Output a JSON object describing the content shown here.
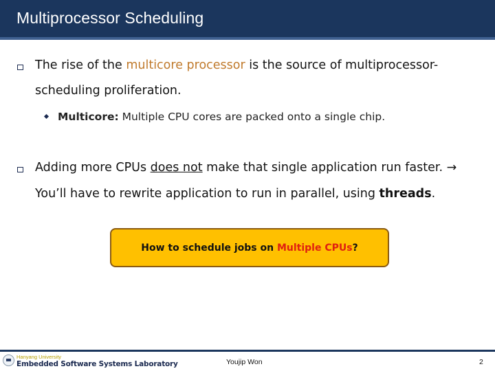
{
  "slide": {
    "title": "Multiprocessor Scheduling"
  },
  "bullets": [
    {
      "line1_pre": "The rise of the ",
      "line1_highlight": "multicore processor",
      "line1_post": " is the source of multiprocessor-",
      "line2": "scheduling proliferation.",
      "sub": {
        "term": "Multicore:",
        "text": " Multiple CPU cores are packed onto a single chip."
      }
    },
    {
      "line1_pre": "Adding more CPUs ",
      "line1_underline": "does not",
      "line1_post": " make that single application run faster. ",
      "arrow": "→",
      "line2_pre": "You’ll have to rewrite application to run in parallel, using ",
      "line2_bold": "threads",
      "line2_post": "."
    }
  ],
  "callout": {
    "pre": "How to schedule jobs on ",
    "highlight": "Multiple CPUs",
    "post": "?"
  },
  "footer": {
    "university": "Hanyang University",
    "lab": "Embedded Software Systems Laboratory",
    "author": "Youjip Won",
    "page": "2"
  },
  "colors": {
    "header": "#1b365d",
    "header_strip": "#3f6090",
    "highlight_orange": "#c07a2c",
    "callout_fill": "#ffc000",
    "callout_border": "#8a5a12",
    "callout_red": "#e02010"
  }
}
